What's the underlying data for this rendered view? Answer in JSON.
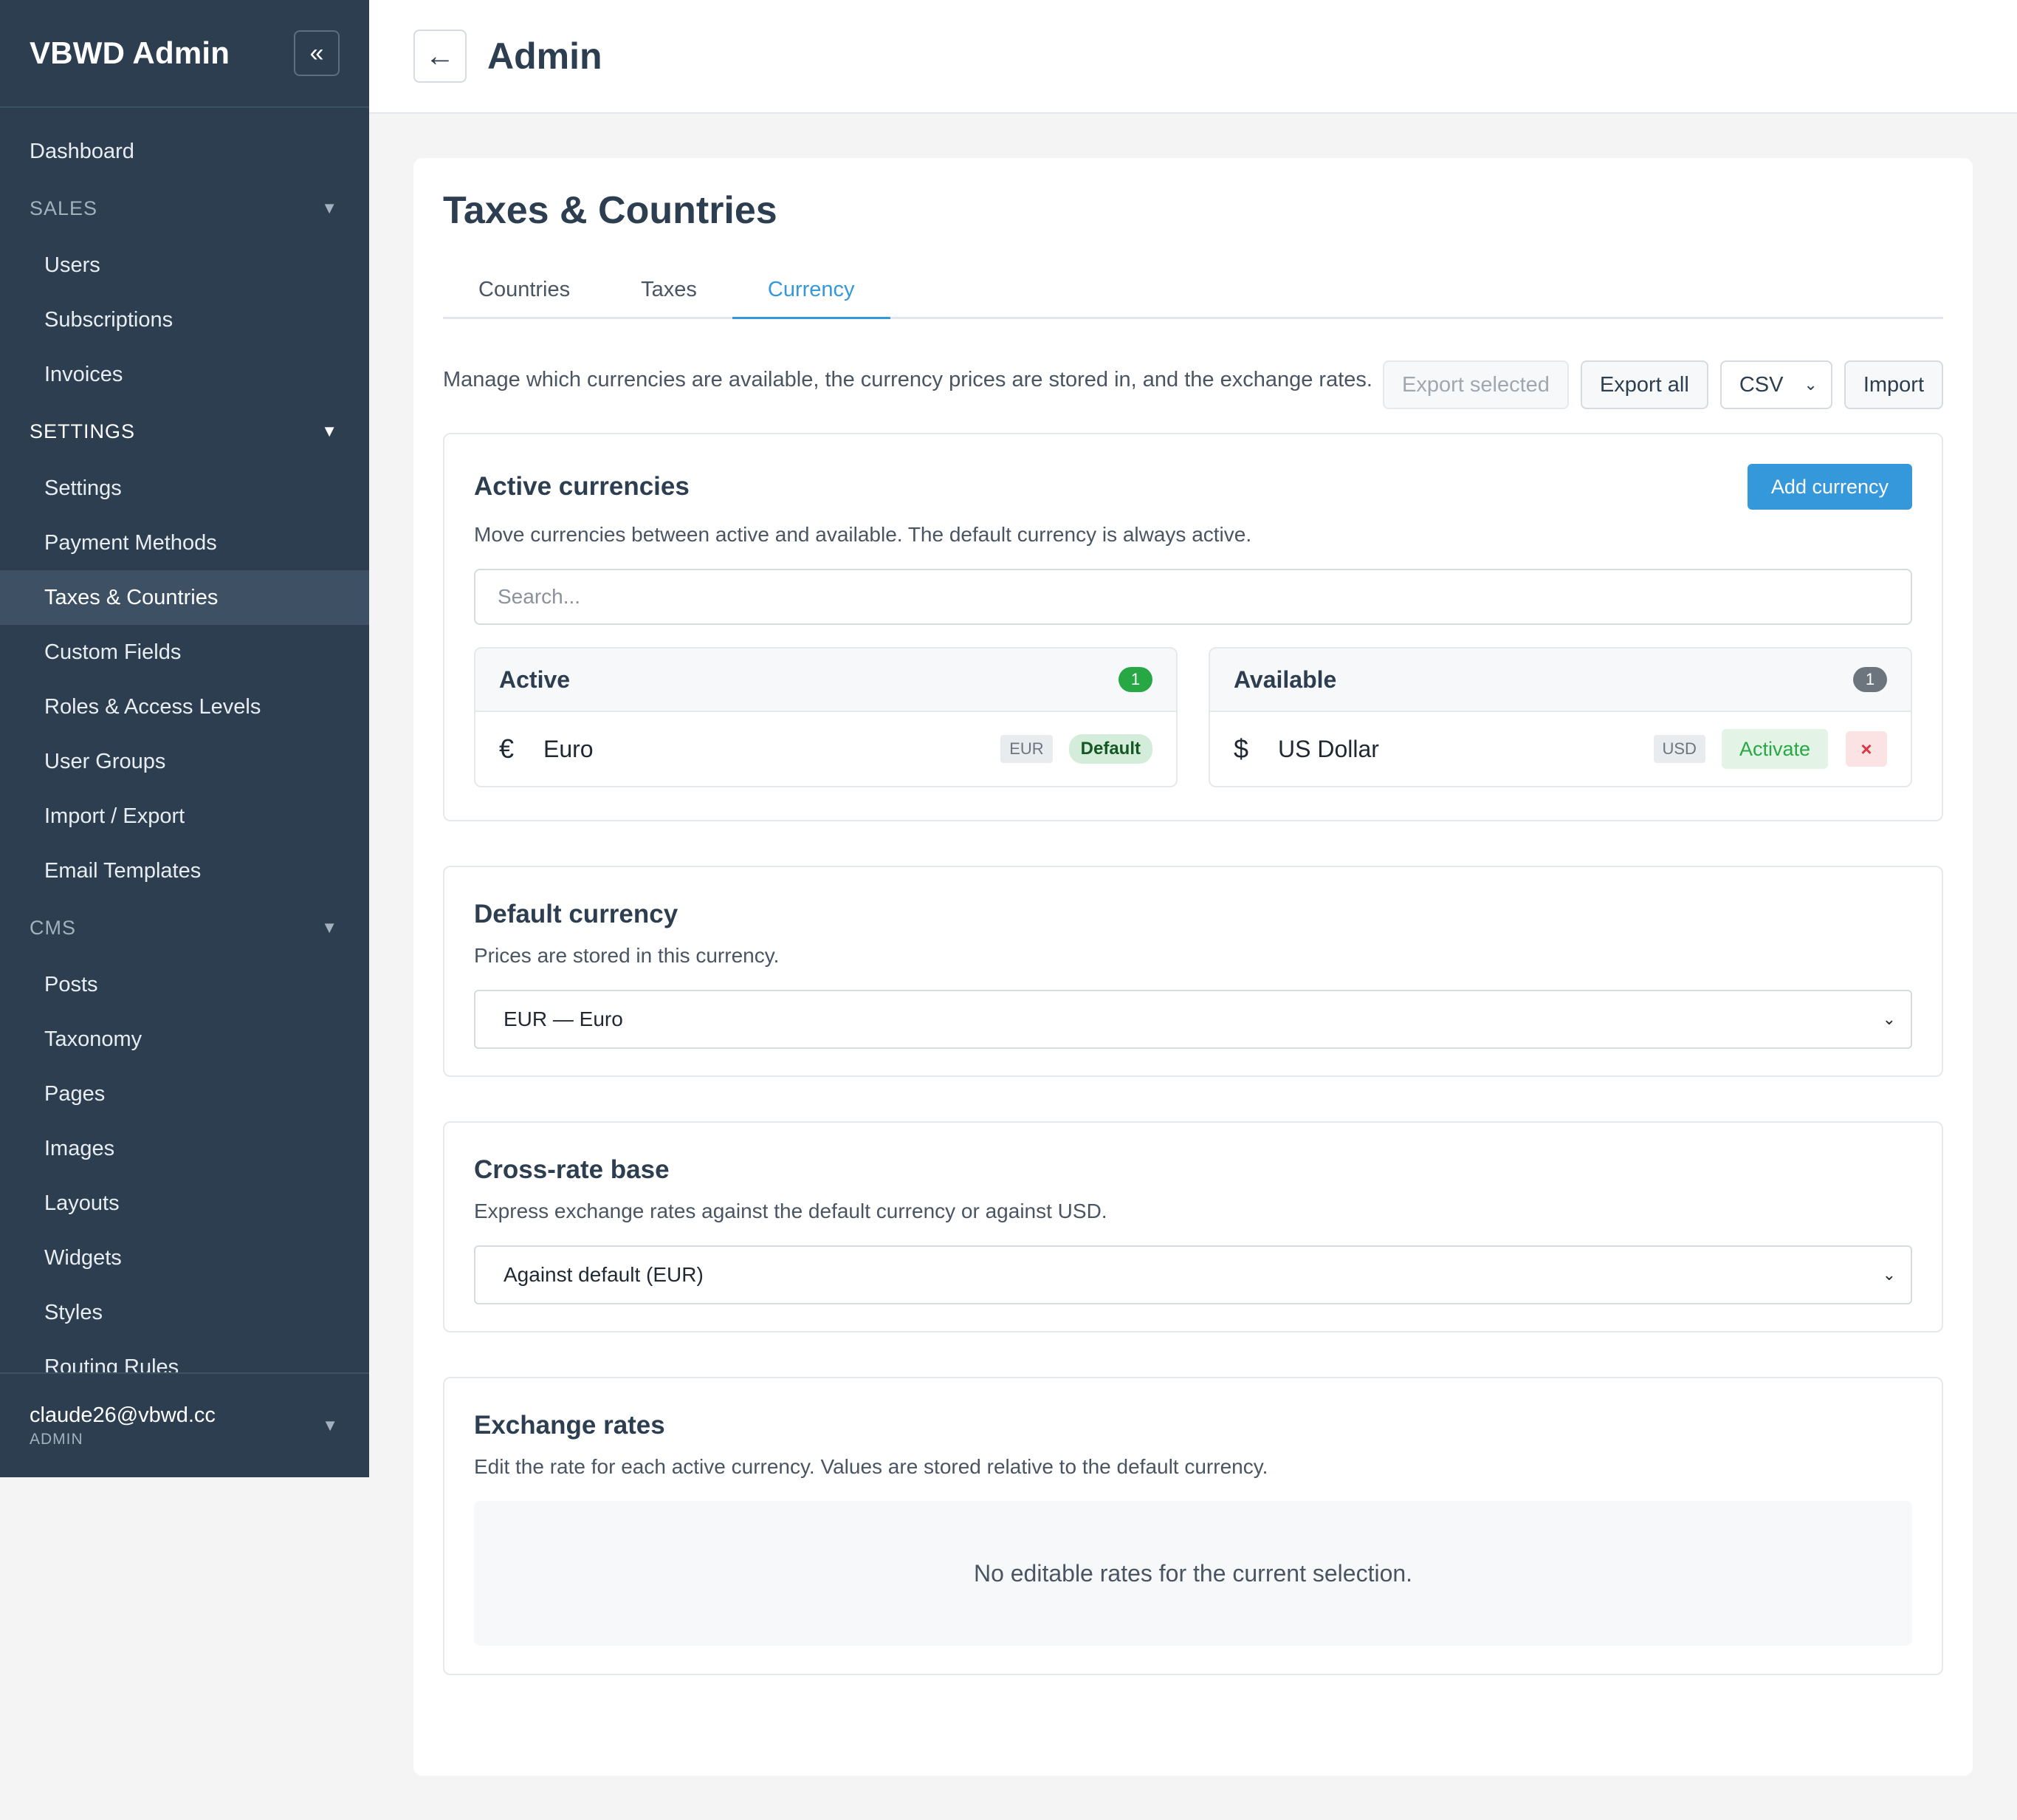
{
  "sidebar": {
    "brand": "VBWD Admin",
    "collapse_glyph": "«",
    "dashboard": "Dashboard",
    "sections": [
      {
        "label": "SALES",
        "items": [
          "Users",
          "Subscriptions",
          "Invoices"
        ]
      },
      {
        "label": "SETTINGS",
        "items": [
          "Settings",
          "Payment Methods",
          "Taxes & Countries",
          "Custom Fields",
          "Roles & Access Levels",
          "User Groups",
          "Import / Export",
          "Email Templates"
        ]
      },
      {
        "label": "CMS",
        "items": [
          "Posts",
          "Taxonomy",
          "Pages",
          "Images",
          "Layouts",
          "Widgets",
          "Styles",
          "Routing Rules"
        ]
      }
    ],
    "active_item": "Taxes & Countries",
    "caret": "▼",
    "user": {
      "email": "claude26@vbwd.cc",
      "role": "ADMIN"
    }
  },
  "topbar": {
    "back_glyph": "←",
    "title": "Admin"
  },
  "page": {
    "title": "Taxes & Countries",
    "tabs": [
      "Countries",
      "Taxes",
      "Currency"
    ],
    "active_tab": "Currency",
    "intro": "Manage which currencies are available, the currency prices are stored in, and the exchange rates.",
    "toolbar": {
      "export_selected": "Export selected",
      "export_all": "Export all",
      "format": "CSV",
      "import": "Import"
    }
  },
  "active_currencies": {
    "title": "Active currencies",
    "add_button": "Add currency",
    "description": "Move currencies between active and available. The default currency is always active.",
    "search_placeholder": "Search...",
    "active": {
      "title": "Active",
      "count": "1",
      "items": [
        {
          "symbol": "€",
          "name": "Euro",
          "code": "EUR",
          "badge": "Default"
        }
      ]
    },
    "available": {
      "title": "Available",
      "count": "1",
      "items": [
        {
          "symbol": "$",
          "name": "US Dollar",
          "code": "USD",
          "action": "Activate",
          "remove": "×"
        }
      ]
    }
  },
  "default_currency": {
    "title": "Default currency",
    "description": "Prices are stored in this currency.",
    "selected": "EUR — Euro"
  },
  "cross_rate": {
    "title": "Cross-rate base",
    "description": "Express exchange rates against the default currency or against USD.",
    "selected": "Against default (EUR)"
  },
  "exchange_rates": {
    "title": "Exchange rates",
    "description": "Edit the rate for each active currency. Values are stored relative to the default currency.",
    "empty": "No editable rates for the current selection."
  },
  "colors": {
    "sidebar": "#2c3e50",
    "accent": "#3498db",
    "success": "#28a745",
    "danger": "#dc3545"
  }
}
